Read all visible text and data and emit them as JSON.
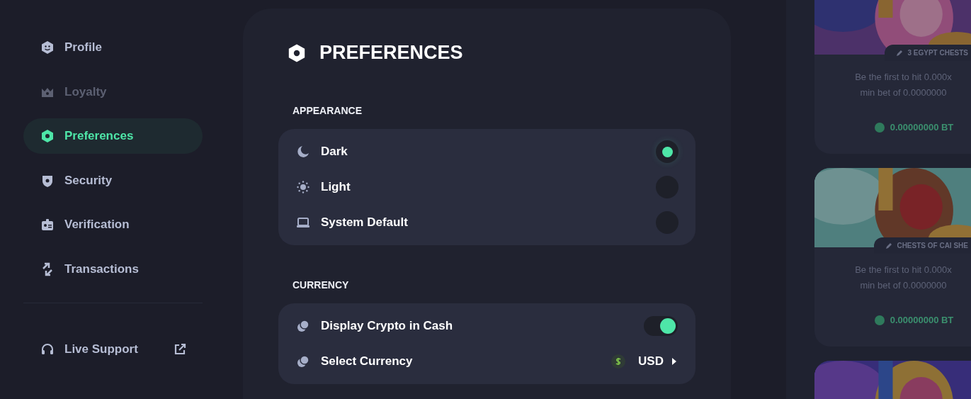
{
  "sidebar": {
    "items": [
      {
        "label": "Profile",
        "selected": false,
        "disabled": false
      },
      {
        "label": "Loyalty",
        "selected": false,
        "disabled": true
      },
      {
        "label": "Preferences",
        "selected": true,
        "disabled": false
      },
      {
        "label": "Security",
        "selected": false,
        "disabled": false
      },
      {
        "label": "Verification",
        "selected": false,
        "disabled": false
      },
      {
        "label": "Transactions",
        "selected": false,
        "disabled": false
      }
    ],
    "support": {
      "label": "Live Support"
    }
  },
  "preferences": {
    "title": "PREFERENCES",
    "appearance": {
      "heading": "APPEARANCE",
      "options": [
        {
          "label": "Dark",
          "selected": true
        },
        {
          "label": "Light",
          "selected": false
        },
        {
          "label": "System Default",
          "selected": false
        }
      ]
    },
    "currency": {
      "heading": "CURRENCY",
      "rows": [
        {
          "kind": "toggle",
          "label": "Display Crypto in Cash",
          "on": true
        },
        {
          "kind": "select",
          "label": "Select Currency",
          "value": "USD"
        }
      ]
    }
  },
  "side_cards": [
    {
      "kind": "game",
      "tag": "3 EGYPT CHESTS",
      "lines": [
        "Be the first to hit 0.000x",
        "min bet of 0.0000000"
      ],
      "amount": "0.00000000 BT"
    },
    {
      "kind": "game",
      "tag": "CHESTS OF CAI SHE",
      "lines": [
        "Be the first to hit 0.000x",
        "min bet of 0.0000000"
      ],
      "amount": "0.00000000 BT"
    },
    {
      "kind": "picture"
    }
  ]
}
